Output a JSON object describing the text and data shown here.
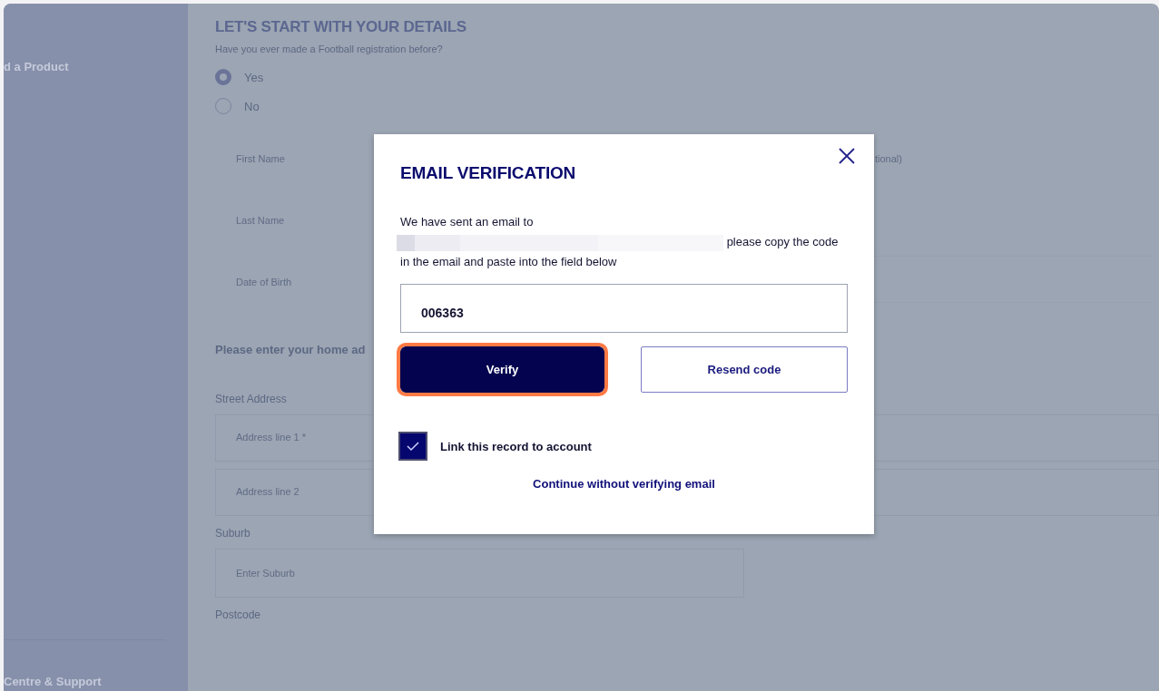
{
  "sidebar": {
    "items": [
      {
        "label": "d a Product"
      },
      {
        "label": "Centre & Support"
      }
    ]
  },
  "form": {
    "title": "LET'S START WITH YOUR DETAILS",
    "question": "Have you ever made a Football registration before?",
    "options": [
      {
        "label": "Yes",
        "selected": true
      },
      {
        "label": "No",
        "selected": false
      }
    ],
    "name_fields": [
      {
        "placeholder": "First Name"
      },
      {
        "placeholder": "Last Name"
      },
      {
        "placeholder": "Date of Birth"
      }
    ],
    "optional_field": {
      "placeholder": "tional)"
    },
    "address_heading": "Please enter your home ad",
    "street_label": "Street Address",
    "address_fields": [
      {
        "placeholder": "Address line 1 *"
      },
      {
        "placeholder": "Address line 2"
      }
    ],
    "suburb_label": "Suburb",
    "suburb_field": {
      "placeholder": "Enter Suburb"
    },
    "postcode_label": "Postcode"
  },
  "dialog": {
    "title": "EMAIL VERIFICATION",
    "message_start": "We have sent an email to",
    "message_end": "please copy the code in the email and paste into the field below",
    "code_field": {
      "value": "006363"
    },
    "buttons": [
      {
        "label": "Verify",
        "kind": "primary",
        "highlighted": true
      },
      {
        "label": "Resend code",
        "kind": "secondary",
        "highlighted": false
      }
    ],
    "link_record": {
      "label": "Link this record to account",
      "checked": true
    },
    "skip_link": "Continue without verifying email"
  }
}
